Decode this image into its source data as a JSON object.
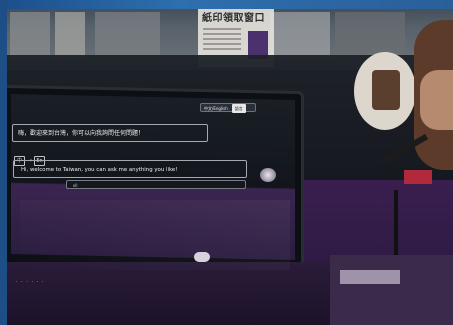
{
  "kiosk": {
    "language_button_label": "中文/English",
    "language_button_tag": "語言",
    "welcome_zh": "嗨，歡迎來到台灣，你可以向我詢問任何問題！",
    "lang_from": "中",
    "lang_to": "En",
    "welcome_en": "Hi, welcome to Taiwan, you can ask me anything you like!",
    "input_text": "ııll"
  },
  "poster": {
    "title": "紙印領取窗口"
  },
  "colors": {
    "top_bar": "#2e6fae",
    "purple_overlay": "#2e1a45",
    "screen_dark": "#12161c"
  }
}
